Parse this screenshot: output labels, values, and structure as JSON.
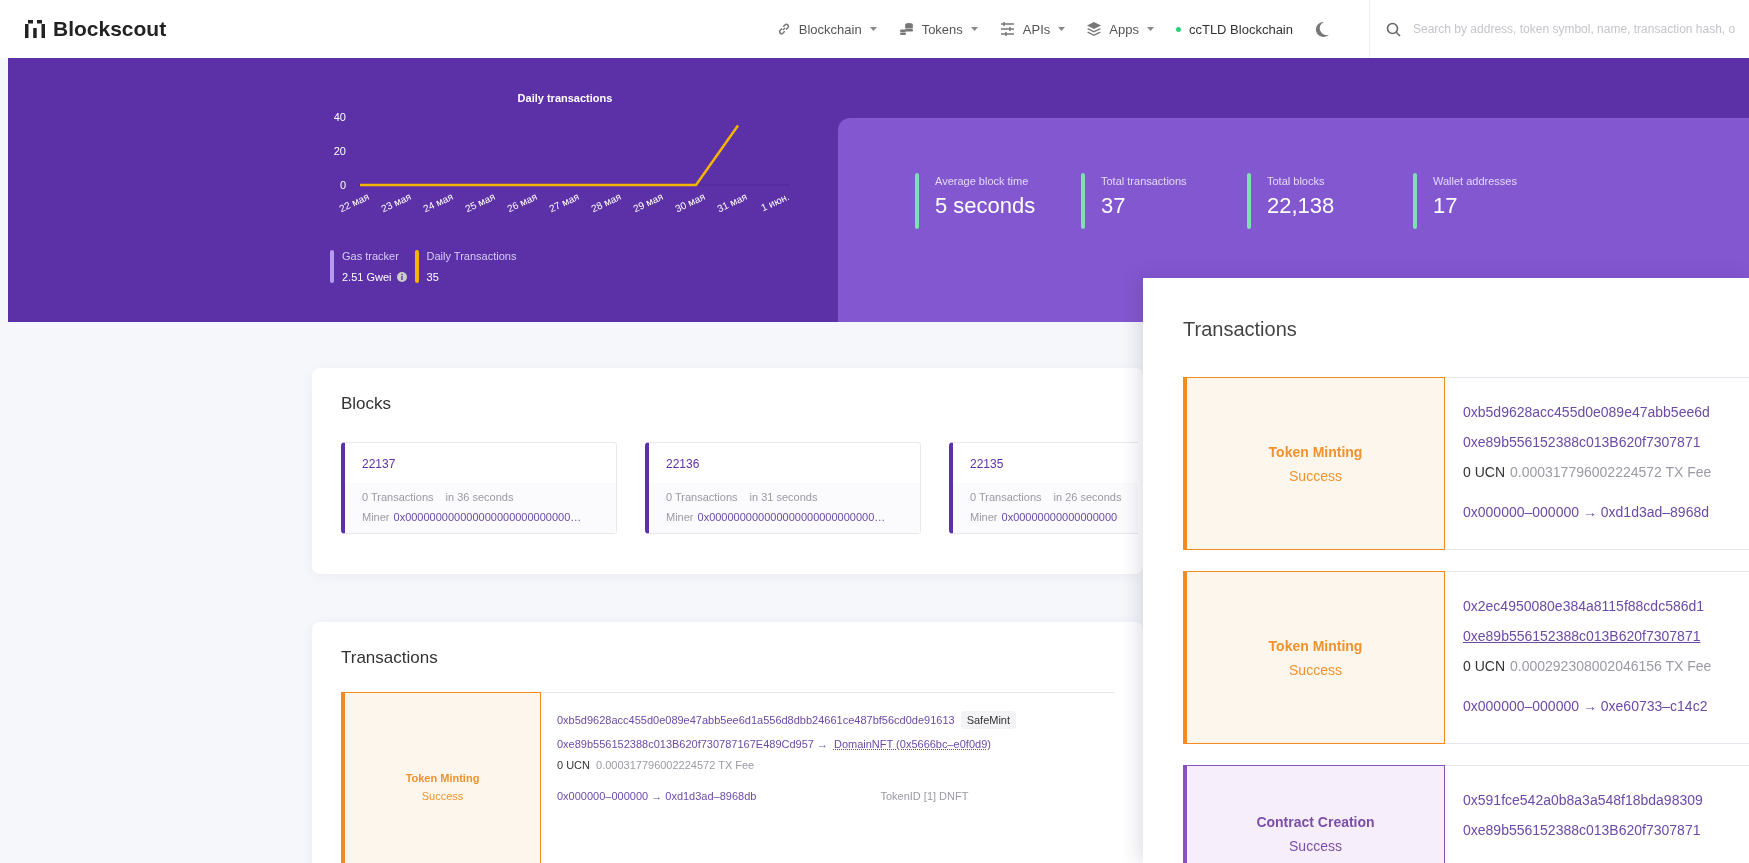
{
  "header": {
    "logo": "Blockscout",
    "nav": [
      {
        "label": "Blockchain"
      },
      {
        "label": "Tokens"
      },
      {
        "label": "APIs"
      },
      {
        "label": "Apps"
      }
    ],
    "network": "ccTLD Blockchain",
    "search": {
      "placeholder": "Search by address, token symbol, name, transaction hash, o"
    }
  },
  "hero": {
    "chart": {
      "chart_data": {
        "type": "line",
        "title": "Daily transactions",
        "categories": [
          "22 мая",
          "23 мая",
          "24 мая",
          "25 мая",
          "26 мая",
          "27 мая",
          "28 мая",
          "29 мая",
          "30 мая",
          "31 мая",
          "1 июн."
        ],
        "series": [
          {
            "color": "#f5b400",
            "values": [
              0,
              0,
              0,
              0,
              0,
              0,
              0,
              0,
              0,
              35,
              null
            ]
          }
        ],
        "ylim": [
          0,
          40
        ],
        "yticks": [
          0,
          20,
          40
        ]
      },
      "legend": [
        {
          "label": "Gas tracker",
          "value": "2.51 Gwei",
          "color": "#b59cf0",
          "info": true
        },
        {
          "label": "Daily Transactions",
          "value": "35",
          "color": "#f5b400",
          "info": false
        }
      ]
    },
    "stats": [
      {
        "label": "Average block time",
        "value": "5 seconds"
      },
      {
        "label": "Total transactions",
        "value": "37"
      },
      {
        "label": "Total blocks",
        "value": "22,138"
      },
      {
        "label": "Wallet addresses",
        "value": "17"
      }
    ]
  },
  "blocks": {
    "title": "Blocks",
    "items": [
      {
        "number": "22137",
        "transactions": "0 Transactions",
        "age": "in 36 seconds",
        "miner_label": "Miner",
        "miner": "0x000000000000000000000000000…"
      },
      {
        "number": "22136",
        "transactions": "0 Transactions",
        "age": "in 31 seconds",
        "miner_label": "Miner",
        "miner": "0x000000000000000000000000000…"
      },
      {
        "number": "22135",
        "transactions": "0 Transactions",
        "age": "in 26 seconds",
        "miner_label": "Miner",
        "miner": "0x00000000000000000"
      }
    ]
  },
  "transactions": {
    "title": "Transactions",
    "rows": [
      {
        "kind": "token_minting",
        "type": "Token Minting",
        "status": "Success",
        "hash": "0xb5d9628acc455d0e089e47abb5ee6d1a556d8dbb24661ce487bf56cd0de91613",
        "method": "SafeMint",
        "from": "0xe89b556152388c013B620f730787167E489Cd957 →",
        "to": "DomainNFT (0x5666bc–e0f0d9)",
        "value": "0 UCN",
        "fee": "0.000317796002224572 TX Fee",
        "transfer": "0x000000–000000 → 0xd1d3ad–8968db",
        "token_id": "TokenID [1] DNFT"
      }
    ]
  },
  "zoomed_panel": {
    "title": "Transactions",
    "rows": [
      {
        "kind": "token_minting",
        "type": "Token Minting",
        "status": "Success",
        "hash": "0xb5d9628acc455d0e089e47abb5ee6d",
        "from": "0xe89b556152388c013B620f7307871",
        "from_hovered": false,
        "value": "0 UCN",
        "fee": "0.000317796002224572 TX Fee",
        "transfer": "0x000000–000000 → 0xd1d3ad–8968d"
      },
      {
        "kind": "token_minting",
        "type": "Token Minting",
        "status": "Success",
        "hash": "0x2ec4950080e384a8115f88cdc586d1",
        "from": "0xe89b556152388c013B620f7307871",
        "from_hovered": true,
        "value": "0 UCN",
        "fee": "0.000292308002046156 TX Fee",
        "transfer": "0x000000–000000 → 0xe60733–c14c2"
      },
      {
        "kind": "contract_creation",
        "type": "Contract Creation",
        "status": "Success",
        "hash": "0x591fce542a0b8a3a548f18bda98309",
        "from": "0xe89b556152388c013B620f7307871",
        "from_hovered": false
      }
    ]
  }
}
